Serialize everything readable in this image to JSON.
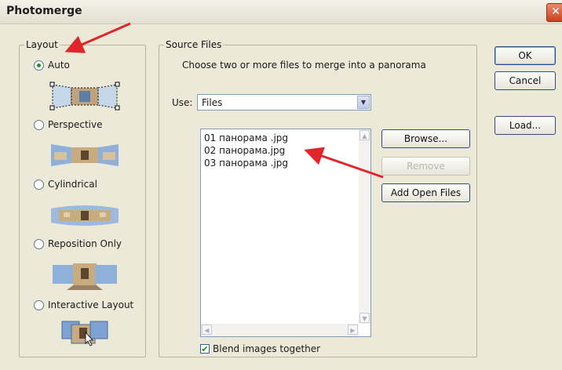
{
  "window": {
    "title": "Photomerge",
    "close_glyph": "✕"
  },
  "layout": {
    "legend": "Layout",
    "options": [
      {
        "label": "Auto",
        "checked": true,
        "thumb": "auto-layout-icon"
      },
      {
        "label": "Perspective",
        "checked": false,
        "thumb": "perspective-layout-icon"
      },
      {
        "label": "Cylindrical",
        "checked": false,
        "thumb": "cylindrical-layout-icon"
      },
      {
        "label": "Reposition Only",
        "checked": false,
        "thumb": "reposition-layout-icon"
      },
      {
        "label": "Interactive Layout",
        "checked": false,
        "thumb": "interactive-layout-icon"
      }
    ]
  },
  "source": {
    "legend": "Source Files",
    "hint": "Choose two or more files to merge into a panorama",
    "use_label": "Use:",
    "use_value": "Files",
    "files": [
      "01 панорама .jpg",
      "02 панорама.jpg",
      "03 панорама .jpg"
    ],
    "browse": "Browse...",
    "remove": "Remove",
    "add_open": "Add Open Files",
    "blend_label": "Blend images together",
    "blend_checked": true
  },
  "actions": {
    "ok": "OK",
    "cancel": "Cancel",
    "load": "Load..."
  },
  "colors": {
    "annotation_arrow": "#e0262b",
    "accent": "#2f4c7a"
  }
}
